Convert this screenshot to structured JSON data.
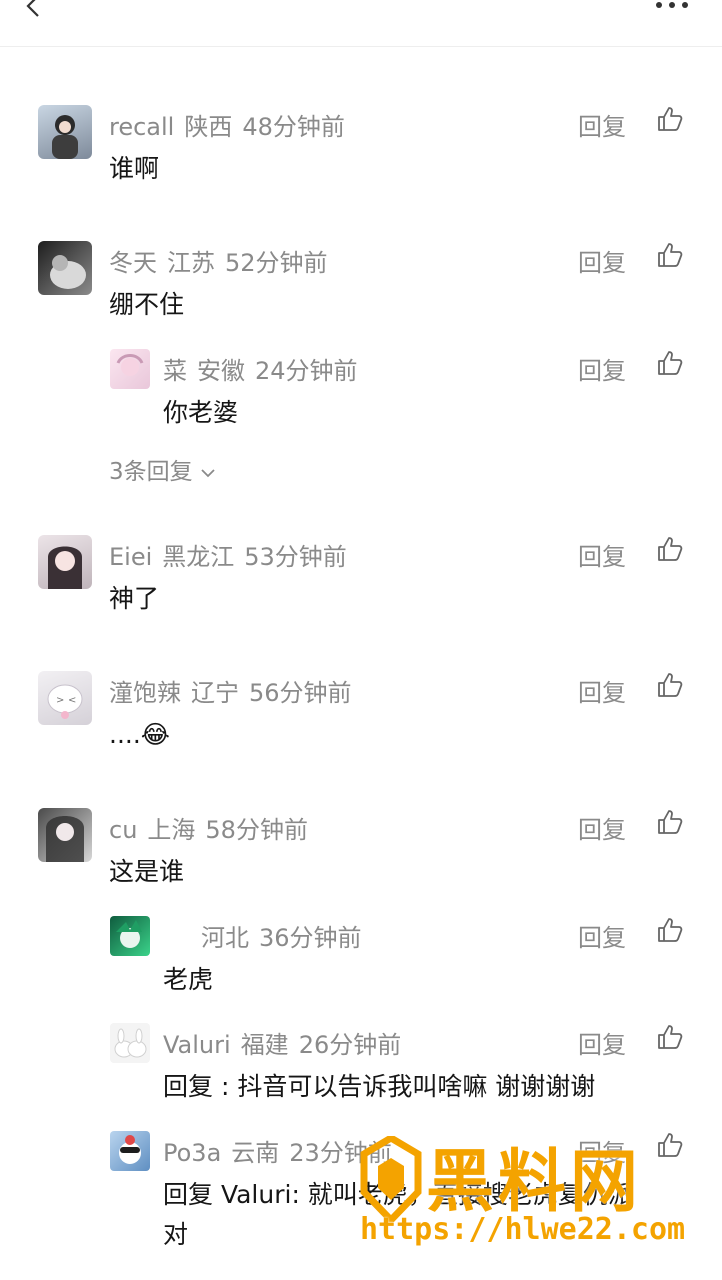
{
  "reply_label": "回复",
  "comments": [
    {
      "user": "recall",
      "region": "陕西",
      "time": "48分钟前",
      "text": "谁啊"
    },
    {
      "user": "冬天",
      "region": "江苏",
      "time": "52分钟前",
      "text": "绷不住",
      "replies": [
        {
          "user": "菜",
          "region": "安徽",
          "time": "24分钟前",
          "text": "你老婆"
        }
      ],
      "more_replies": "3条回复"
    },
    {
      "user": "Eiei",
      "region": "黑龙江",
      "time": "53分钟前",
      "text": "神了"
    },
    {
      "user": "潼饱辣",
      "region": "辽宁",
      "time": "56分钟前",
      "text": "....😂"
    },
    {
      "user": "cu",
      "region": "上海",
      "time": "58分钟前",
      "text": "这是谁",
      "replies": [
        {
          "user": "",
          "region": "河北",
          "time": "36分钟前",
          "text": "老虎"
        },
        {
          "user": "Valuri",
          "region": "福建",
          "time": "26分钟前",
          "text": "回复    : 抖音可以告诉我叫啥嘛 谢谢谢谢"
        },
        {
          "user": "Po3a",
          "region": "云南",
          "time": "23分钟前",
          "text": "回复 Valuri: 就叫老虎，直接搜老虎复仇派",
          "text2": "对"
        }
      ]
    }
  ],
  "watermark": {
    "title": "黑料网",
    "url": "https://hlwe22.com"
  },
  "colors": {
    "accent": "#f4a300",
    "meta": "#8a8a8a"
  }
}
